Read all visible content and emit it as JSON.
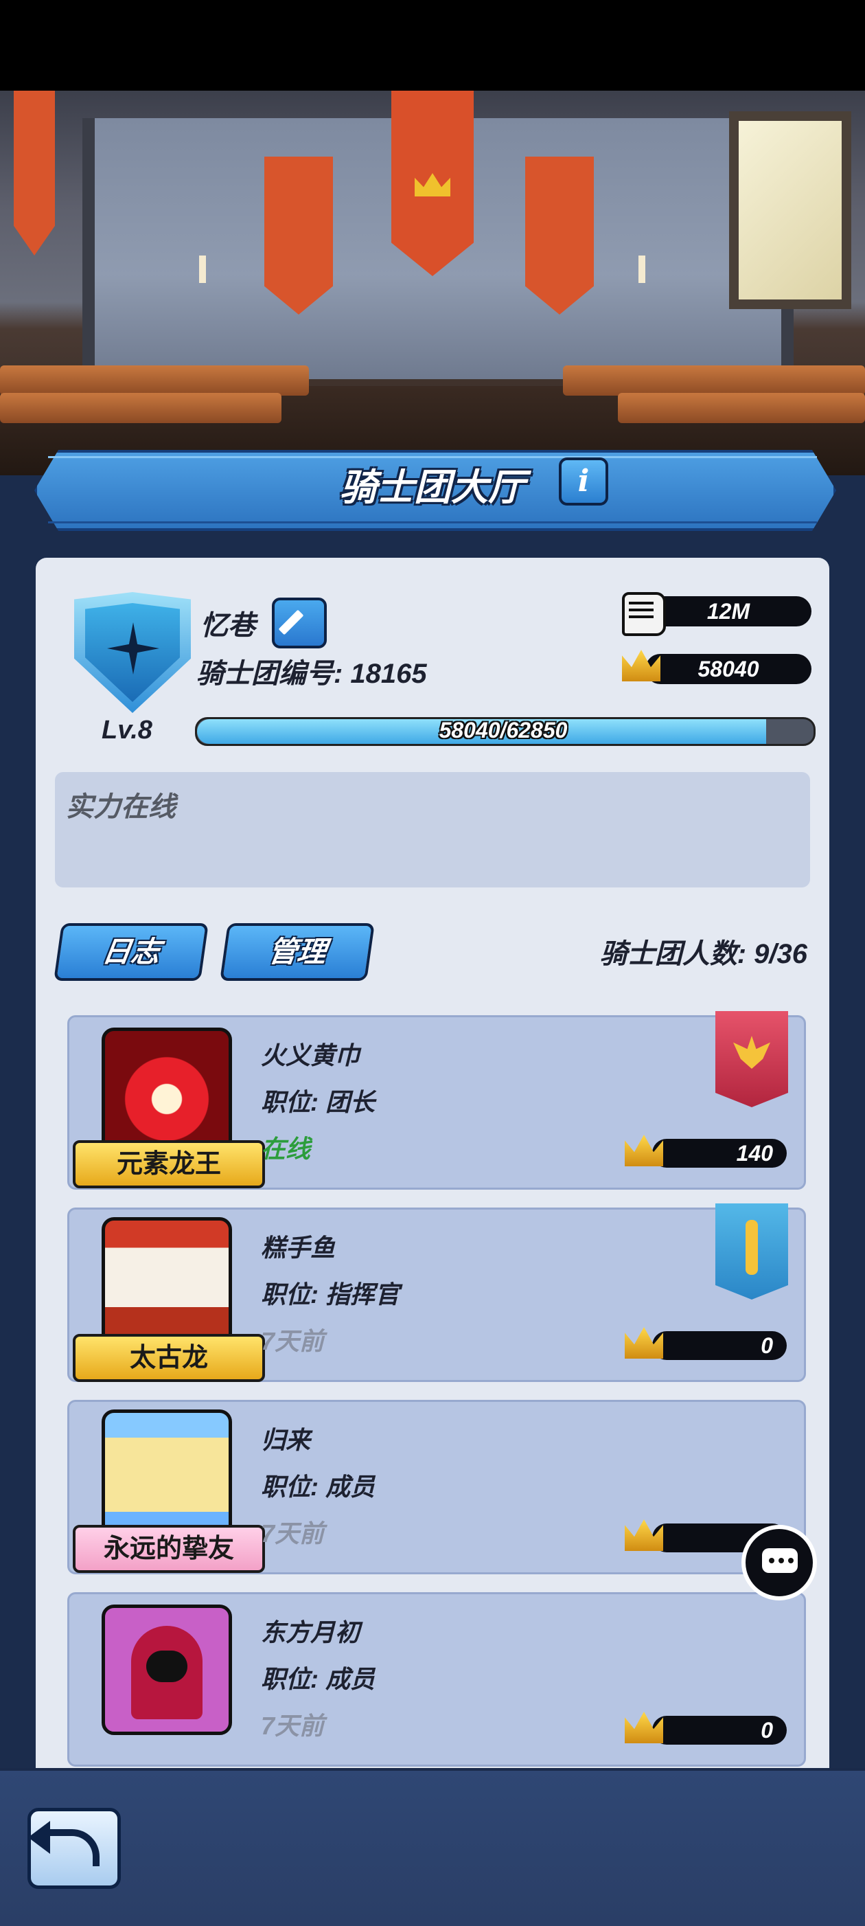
{
  "screen": {
    "title": "骑士团大厅",
    "info_icon": "info-icon"
  },
  "guild": {
    "name": "忆巷",
    "id_label": "骑士团编号: 18165",
    "level": "Lv.8",
    "power": "12M",
    "crowns": "58040",
    "xp_text": "58040/62850",
    "xp_current": 58040,
    "xp_max": 62850,
    "notice": "实力在线"
  },
  "tabs": {
    "log": "日志",
    "manage": "管理"
  },
  "member_count": "骑士团人数: 9/36",
  "members": [
    {
      "name": "火义黄巾",
      "role": "职位: 团长",
      "status": "在线",
      "title": "元素龙王",
      "crowns": "140",
      "flag": "red"
    },
    {
      "name": "糕手鱼",
      "role": "职位: 指挥官",
      "status": "7天前",
      "title": "太古龙",
      "crowns": "0",
      "flag": "blue"
    },
    {
      "name": "归来",
      "role": "职位: 成员",
      "status": "7天前",
      "title": "永远的挚友",
      "crowns": "",
      "flag": ""
    },
    {
      "name": "东方月初",
      "role": "职位: 成员",
      "status": "7天前",
      "title": "",
      "crowns": "0",
      "flag": ""
    }
  ],
  "icons": {
    "power": "fist-icon",
    "crown": "crown-icon",
    "edit": "pencil-icon",
    "chat": "chat-icon",
    "back": "back-arrow-icon"
  },
  "colors": {
    "accent": "#2d74c0",
    "online": "#2c9d3c",
    "panel": "#e4e9f2"
  }
}
